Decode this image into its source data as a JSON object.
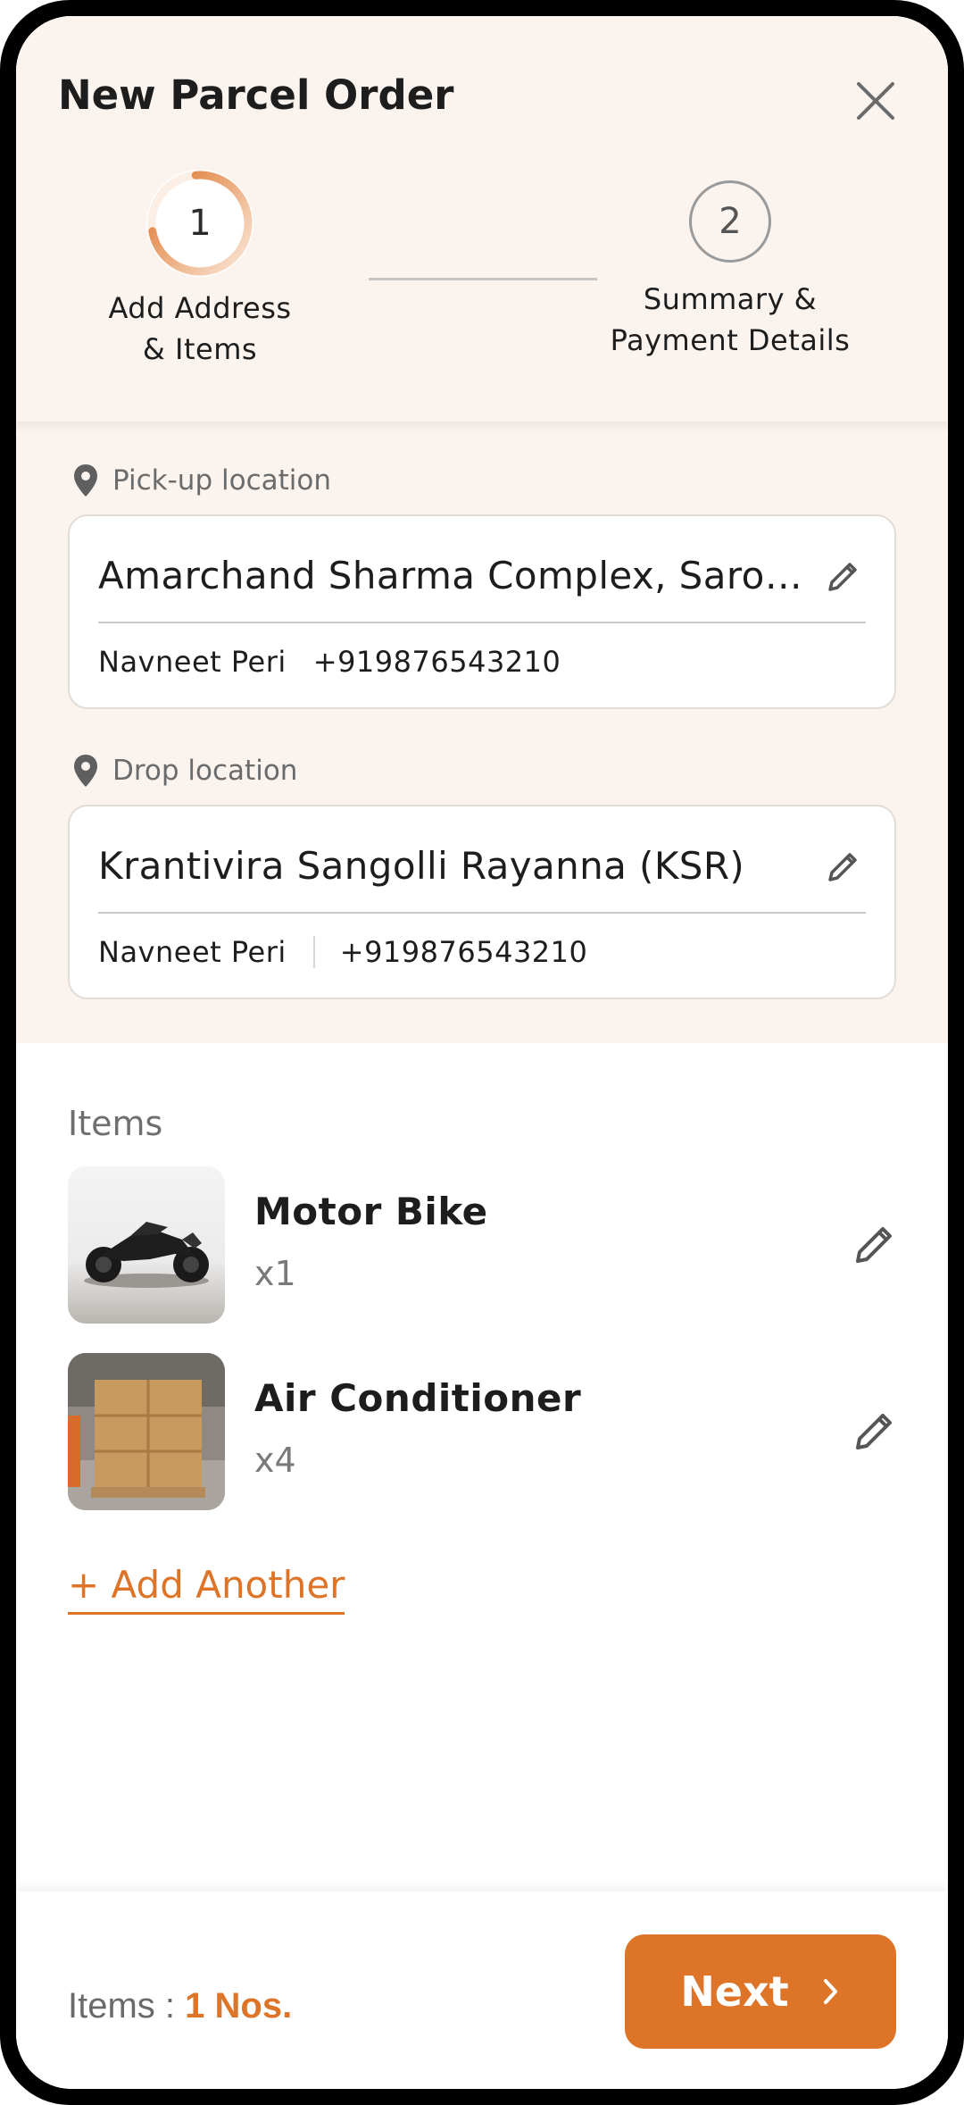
{
  "header": {
    "title": "New Parcel Order",
    "close_icon": "close-icon"
  },
  "stepper": {
    "steps": [
      {
        "number": "1",
        "label_line1": "Add Address",
        "label_line2": "& Items",
        "active": true
      },
      {
        "number": "2",
        "label_line1": "Summary &",
        "label_line2": "Payment Details",
        "active": false
      }
    ]
  },
  "pickup": {
    "label": "Pick-up location",
    "address": "Amarchand Sharma Complex, Sarojini Nagar",
    "name": "Navneet Peri",
    "phone": "+919876543210"
  },
  "drop": {
    "label": "Drop location",
    "address": "Krantivira Sangolli Rayanna (KSR)",
    "name": "Navneet Peri",
    "phone": "+919876543210"
  },
  "items": {
    "title": "Items",
    "list": [
      {
        "name": "Motor Bike",
        "qty": "x1"
      },
      {
        "name": "Air Conditioner",
        "qty": "x4"
      }
    ],
    "add_another": "+ Add Another"
  },
  "footer": {
    "count_label": "Items : ",
    "count_value": "1 Nos.",
    "next_label": "Next"
  },
  "colors": {
    "accent": "#dd7428",
    "header_bg": "#fbf3ed"
  }
}
